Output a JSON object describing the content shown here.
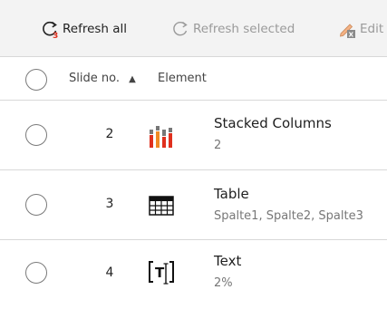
{
  "toolbar": {
    "refresh_all": "Refresh all",
    "refresh_selected": "Refresh selected",
    "edit": "Edit"
  },
  "table": {
    "col_slide": "Slide no.",
    "col_element": "Element",
    "sort_glyph": "▲",
    "rows": [
      {
        "slide": "2",
        "name": "Stacked Columns",
        "detail": "2",
        "icon": "stacked-columns-icon"
      },
      {
        "slide": "3",
        "name": "Table",
        "detail": "Spalte1, Spalte2, Spalte3",
        "icon": "table-icon"
      },
      {
        "slide": "4",
        "name": "Text",
        "detail": "2%",
        "icon": "text-box-icon"
      }
    ]
  },
  "colors": {
    "accent_red": "#e0301e",
    "accent_orange": "#f08a24",
    "icon_gray": "#666666"
  }
}
